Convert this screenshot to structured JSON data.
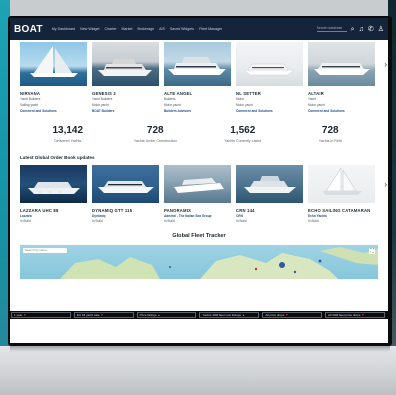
{
  "nav": {
    "logo": "BOAT",
    "links": [
      "My Dashboard",
      "New Widget",
      "Charter",
      "Market",
      "Brokerage",
      "AIS",
      "Saved Widgets",
      "Fleet Manager"
    ],
    "search_placeholder": "Search database"
  },
  "featured": [
    {
      "name": "NIRVANA",
      "line1": "Yacht Builders",
      "line2": "Sailing yacht",
      "line3": "Comment and Solutions"
    },
    {
      "name": "GENESIS 2",
      "line1": "Yacht Builders",
      "line2": "Motor yacht",
      "line3": "BOAT Builders"
    },
    {
      "name": "ALTE ANGEL",
      "line1": "Builders",
      "line2": "Motor yacht",
      "line3": "Builders Advisors"
    },
    {
      "name": "NL SETTER",
      "line1": "Motor",
      "line2": "Motor yacht",
      "line3": "Comment and Solutions"
    },
    {
      "name": "ALTAIR",
      "line1": "Yacht",
      "line2": "Motor yacht",
      "line3": "Comment and Solutions"
    }
  ],
  "stats": [
    {
      "value": "13,142",
      "label": "Delivered Yachts"
    },
    {
      "value": "728",
      "label": "Yachts Under Construction"
    },
    {
      "value": "1,562",
      "label": "Yachts Currently Listed"
    },
    {
      "value": "728",
      "label": "Yachts in Refit"
    }
  ],
  "orderbook": {
    "title": "Latest Global Order Book updates",
    "items": [
      {
        "name": "LAZZARA UHC 88",
        "line1": "Lazzara",
        "line2": "In Build"
      },
      {
        "name": "DYNAMIQ GTT 115",
        "line1": "Dynamiq",
        "line2": "In Build"
      },
      {
        "name": "PANORAMIX",
        "line1": "Admiral - The Italian Sea Group",
        "line2": "In Build"
      },
      {
        "name": "CRN 144",
        "line1": "CRN",
        "line2": "In Build"
      },
      {
        "name": "ECHO SAILING CATAMARAN",
        "line1": "Echo Yachts",
        "line2": "In Build"
      }
    ]
  },
  "tracker": {
    "title": "Global Fleet Tracker",
    "search_placeholder": "Search by name"
  },
  "ticker": [
    {
      "label": "1 year",
      "delta": "▼"
    },
    {
      "label": "EU 18 yacht sale",
      "delta": "▼"
    },
    {
      "label": "Price listings",
      "delta": "▲"
    },
    {
      "label": "Yachts 30M fleet new listings",
      "delta": "▲"
    },
    {
      "label": "All price drops",
      "delta": "▼"
    },
    {
      "label": "All 30M fleet price drops",
      "delta": "▼"
    }
  ],
  "colors": {
    "nav_bg": "#14243a",
    "accent": "#1f6fb2",
    "ticker_down": "#e0483c"
  }
}
